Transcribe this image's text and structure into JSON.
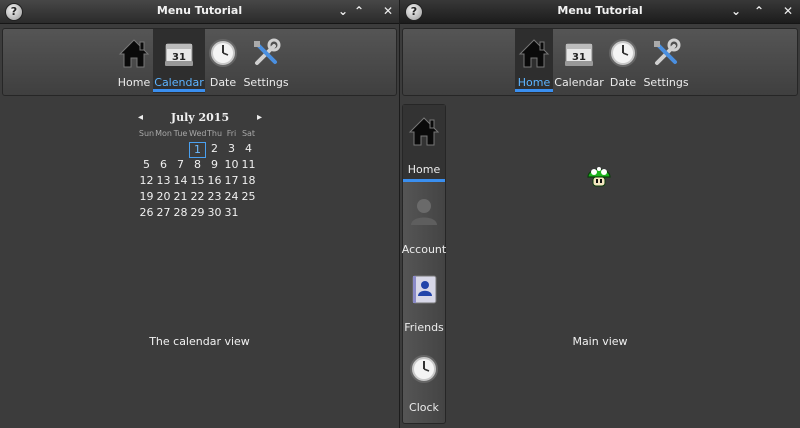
{
  "left_window": {
    "title": "Menu Tutorial",
    "help_glyph": "?",
    "controls": [
      "⌄",
      "⌃",
      "✕"
    ],
    "toolbar": [
      {
        "label": "Home",
        "icon": "home-icon",
        "active": false
      },
      {
        "label": "Calendar",
        "icon": "calendar-icon",
        "active": true
      },
      {
        "label": "Date",
        "icon": "clock-icon",
        "active": false
      },
      {
        "label": "Settings",
        "icon": "settings-icon",
        "active": false
      }
    ],
    "calendar_icon_text": "31",
    "calendar": {
      "month_label": "July 2015",
      "prev": "◂",
      "next": "▸",
      "weekdays": [
        "Sun",
        "Mon",
        "Tue",
        "Wed",
        "Thu",
        "Fri",
        "Sat"
      ],
      "selected_day": "1",
      "weeks": [
        [
          "",
          "",
          "",
          "1",
          "2",
          "3",
          "4"
        ],
        [
          "5",
          "6",
          "7",
          "8",
          "9",
          "10",
          "11"
        ],
        [
          "12",
          "13",
          "14",
          "15",
          "16",
          "17",
          "18"
        ],
        [
          "19",
          "20",
          "21",
          "22",
          "23",
          "24",
          "25"
        ],
        [
          "26",
          "27",
          "28",
          "29",
          "30",
          "31",
          ""
        ]
      ]
    },
    "caption": "The calendar view"
  },
  "right_window": {
    "title": "Menu Tutorial",
    "help_glyph": "?",
    "controls": [
      "⌄",
      "⌃",
      "✕"
    ],
    "toolbar": [
      {
        "label": "Home",
        "icon": "home-icon",
        "active": true
      },
      {
        "label": "Calendar",
        "icon": "calendar-icon",
        "active": false
      },
      {
        "label": "Date",
        "icon": "clock-icon",
        "active": false
      },
      {
        "label": "Settings",
        "icon": "settings-icon",
        "active": false
      }
    ],
    "calendar_icon_text": "31",
    "side_menu": [
      {
        "label": "Home",
        "icon": "home-icon",
        "active": true
      },
      {
        "label": "Account",
        "icon": "account-icon",
        "active": false
      },
      {
        "label": "Friends",
        "icon": "friends-icon",
        "active": false
      },
      {
        "label": "Clock",
        "icon": "clock-icon",
        "active": false
      }
    ],
    "main_icon": "mushroom-icon",
    "caption": "Main view"
  },
  "colors": {
    "accent": "#3a8ff0",
    "active_label": "#5db4ff",
    "background": "#3c3c3c"
  }
}
